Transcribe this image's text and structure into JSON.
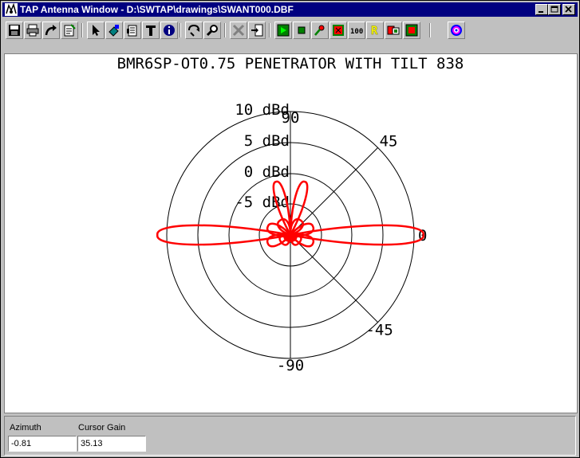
{
  "window": {
    "title": "TAP Antenna Window - D:\\SWTAP\\drawings\\SWANT000.DBF"
  },
  "toolbar": {
    "buttons": [
      {
        "name": "save",
        "icon": "floppy-icon"
      },
      {
        "name": "print",
        "icon": "printer-icon"
      },
      {
        "name": "export",
        "icon": "curved-arrow-icon"
      },
      {
        "name": "edit",
        "icon": "notepad-icon"
      },
      {
        "name": "select",
        "icon": "pointer-icon"
      },
      {
        "name": "paint",
        "icon": "paint-icon"
      },
      {
        "name": "properties",
        "icon": "form-icon"
      },
      {
        "name": "text",
        "icon": "text-t-icon"
      },
      {
        "name": "info",
        "icon": "info-icon"
      },
      {
        "name": "rotate",
        "icon": "rotate-icon"
      },
      {
        "name": "search",
        "icon": "magnifier-icon"
      },
      {
        "name": "delete",
        "icon": "x-icon"
      },
      {
        "name": "import",
        "icon": "import-icon"
      },
      {
        "name": "play",
        "icon": "green-play-icon"
      },
      {
        "name": "stop",
        "icon": "green-square-icon"
      },
      {
        "name": "pin",
        "icon": "pin-icon"
      },
      {
        "name": "mark",
        "icon": "red-box-icon"
      },
      {
        "name": "zoom100",
        "icon": "zoom-100-icon",
        "label": "100%"
      },
      {
        "name": "refresh",
        "icon": "r-icon",
        "label": "R"
      },
      {
        "name": "compare",
        "icon": "compare-icon"
      },
      {
        "name": "grid",
        "icon": "grid-icon"
      },
      {
        "name": "target",
        "icon": "target-icon"
      }
    ]
  },
  "chart_data": {
    "type": "polar",
    "title": "BMR6SP-OT0.75 PENETRATOR WITH TILT 838",
    "radial_ticks": [
      "10 dBd",
      "5 dBd",
      "0 dBd",
      "-5 dBd"
    ],
    "angle_labels": [
      "90",
      "45",
      "0",
      "-45",
      "-90"
    ],
    "series": [
      {
        "color": "#ff0000",
        "lobes": [
          {
            "angle_deg": 0,
            "gain_dBd": 11.5
          },
          {
            "angle_deg": 180,
            "gain_dBd": 11.5
          },
          {
            "angle_deg": 75,
            "gain_dBd": -1
          },
          {
            "angle_deg": 105,
            "gain_dBd": -1
          },
          {
            "angle_deg": 55,
            "gain_dBd": -7
          },
          {
            "angle_deg": 125,
            "gain_dBd": -7
          },
          {
            "angle_deg": 20,
            "gain_dBd": -6
          },
          {
            "angle_deg": 160,
            "gain_dBd": -6
          },
          {
            "angle_deg": 35,
            "gain_dBd": -10
          },
          {
            "angle_deg": 145,
            "gain_dBd": -10
          },
          {
            "angle_deg": -20,
            "gain_dBd": -6
          },
          {
            "angle_deg": -160,
            "gain_dBd": -6
          },
          {
            "angle_deg": -40,
            "gain_dBd": -8
          },
          {
            "angle_deg": -140,
            "gain_dBd": -8
          },
          {
            "angle_deg": -60,
            "gain_dBd": -9
          },
          {
            "angle_deg": -120,
            "gain_dBd": -9
          },
          {
            "angle_deg": -80,
            "gain_dBd": -9
          },
          {
            "angle_deg": -100,
            "gain_dBd": -9
          }
        ]
      }
    ]
  },
  "status": {
    "azimuth_label": "Azimuth",
    "azimuth_value": "-0.81",
    "gain_label": "Cursor Gain",
    "gain_value": "35.13"
  }
}
